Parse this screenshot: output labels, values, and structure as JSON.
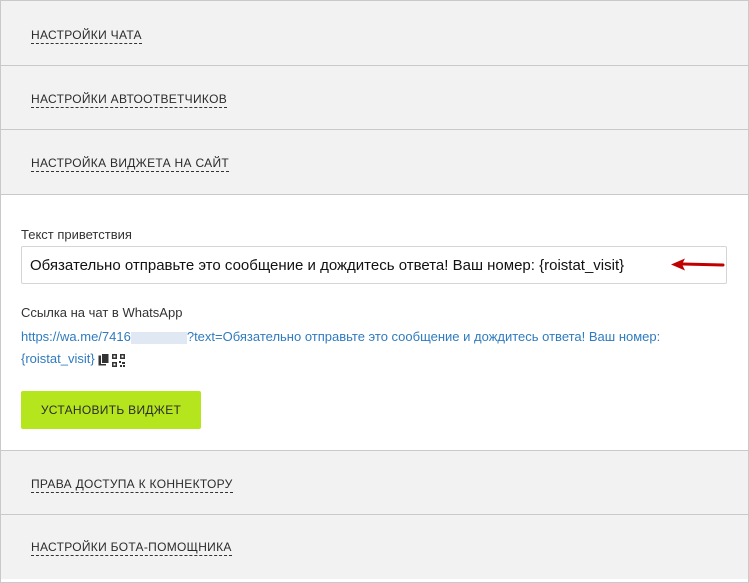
{
  "sections": {
    "chat_settings": "НАСТРОЙКИ ЧАТА",
    "autoresponder_settings": "НАСТРОЙКИ АВТООТВЕТЧИКОВ",
    "widget_settings": "НАСТРОЙКА ВИДЖЕТА НА САЙТ",
    "access_rights": "ПРАВА ДОСТУПА К КОННЕКТОРУ",
    "bot_settings": "НАСТРОЙКИ БОТА-ПОМОЩНИКА"
  },
  "widget": {
    "greeting_label": "Текст приветствия",
    "greeting_value": "Обязательно отправьте это сообщение и дождитесь ответа! Ваш номер: {roistat_visit}",
    "link_label": "Ссылка на чат в WhatsApp",
    "link_prefix": "https://wa.me/7416",
    "link_suffix_line1": "?text=Обязательно отправьте это сообщение и дождитесь ответа! Ваш номер:",
    "link_suffix_line2": "{roistat_visit}",
    "install_button": "УСТАНОВИТЬ ВИДЖЕТ",
    "icons": [
      "copy-icon",
      "qr-code-icon"
    ]
  },
  "colors": {
    "accent_button": "#b5e61d",
    "link": "#2f7bbf",
    "arrow": "#c00000"
  }
}
